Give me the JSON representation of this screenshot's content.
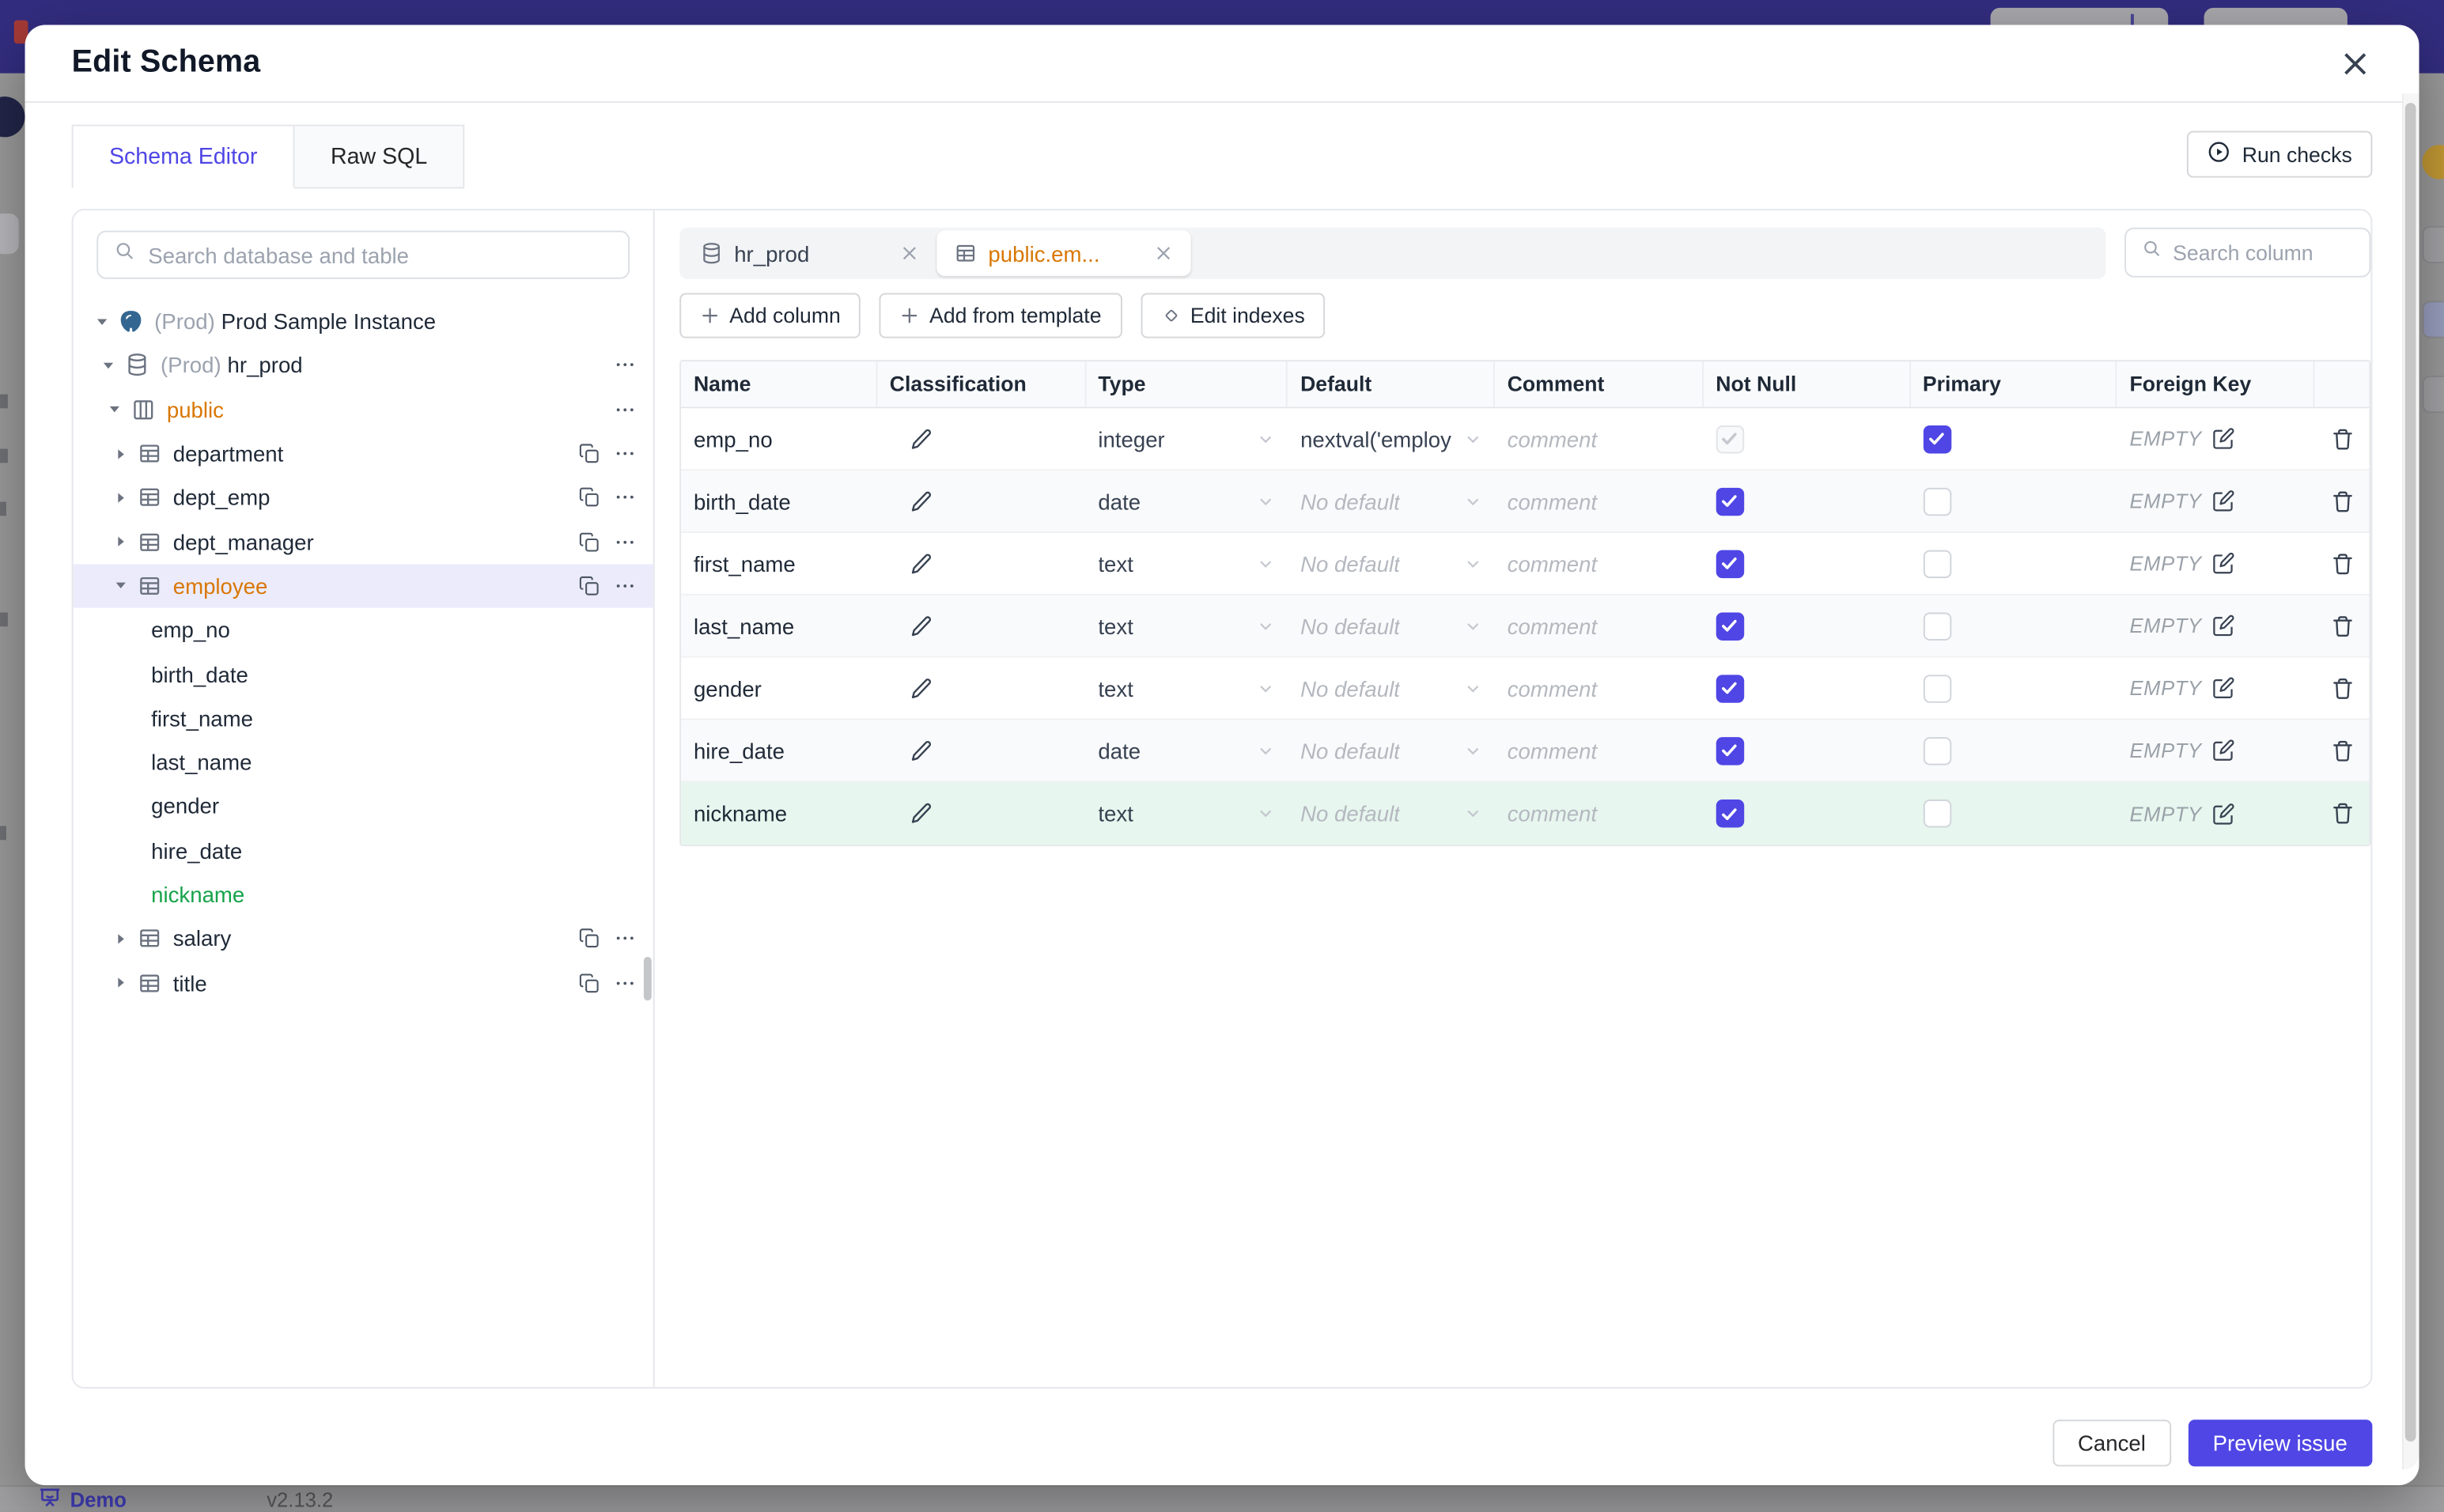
{
  "colors": {
    "accent": "#4f46e5",
    "amber": "#d97706",
    "green": "#16a34a",
    "navy": "#332d80",
    "highlight": "#e7f6ee"
  },
  "backdrop": {
    "bottombar": {
      "demo_label": "Demo",
      "version": "v2.13.2"
    }
  },
  "modal": {
    "title": "Edit Schema",
    "run_checks_label": "Run checks",
    "tabs": [
      {
        "label": "Schema Editor",
        "active": true
      },
      {
        "label": "Raw SQL",
        "active": false
      }
    ],
    "sidebar": {
      "search_placeholder": "Search database and table",
      "tree": [
        {
          "level": 0,
          "arrow": "down",
          "icon": "postgres",
          "prefix": "(Prod)",
          "label": "Prod Sample Instance"
        },
        {
          "level": 1,
          "arrow": "down",
          "icon": "database",
          "prefix": "(Prod)",
          "label": "hr_prod",
          "more": true
        },
        {
          "level": 2,
          "arrow": "down",
          "icon": "schema",
          "label": "public",
          "color": "amber",
          "more": true
        },
        {
          "level": 3,
          "arrow": "right",
          "icon": "table",
          "label": "department",
          "copy": true,
          "more": true
        },
        {
          "level": 3,
          "arrow": "right",
          "icon": "table",
          "label": "dept_emp",
          "copy": true,
          "more": true
        },
        {
          "level": 3,
          "arrow": "right",
          "icon": "table",
          "label": "dept_manager",
          "copy": true,
          "more": true
        },
        {
          "level": 3,
          "arrow": "down",
          "icon": "table",
          "label": "employee",
          "color": "amber",
          "selected": true,
          "copy": true,
          "more": true
        },
        {
          "level": 4,
          "label": "emp_no"
        },
        {
          "level": 4,
          "label": "birth_date"
        },
        {
          "level": 4,
          "label": "first_name"
        },
        {
          "level": 4,
          "label": "last_name"
        },
        {
          "level": 4,
          "label": "gender"
        },
        {
          "level": 4,
          "label": "hire_date"
        },
        {
          "level": 4,
          "label": "nickname",
          "color": "green"
        },
        {
          "level": 3,
          "arrow": "right",
          "icon": "table",
          "label": "salary",
          "copy": true,
          "more": true
        },
        {
          "level": 3,
          "arrow": "right",
          "icon": "table",
          "label": "title",
          "copy": true,
          "more": true
        }
      ]
    },
    "editor": {
      "chips": [
        {
          "label": "hr_prod",
          "icon": "database",
          "active": false
        },
        {
          "label": "public.em...",
          "icon": "table",
          "active": true
        }
      ],
      "column_search_placeholder": "Search column",
      "actions": [
        {
          "label": "Add column",
          "icon": "plus"
        },
        {
          "label": "Add from template",
          "icon": "plus"
        },
        {
          "label": "Edit indexes",
          "icon": "diamond"
        }
      ],
      "table": {
        "headers": [
          "Name",
          "Classification",
          "Type",
          "Default",
          "Comment",
          "Not Null",
          "Primary",
          "Foreign Key",
          ""
        ],
        "comment_placeholder": "comment",
        "foreign_key_empty": "EMPTY",
        "rows": [
          {
            "name": "emp_no",
            "type": "integer",
            "default": "nextval('employ",
            "default_is_placeholder": false,
            "not_null": "checked-disabled",
            "primary": "checked",
            "highlight": false
          },
          {
            "name": "birth_date",
            "type": "date",
            "default": "No default",
            "default_is_placeholder": true,
            "not_null": "checked",
            "primary": "unchecked",
            "highlight": false
          },
          {
            "name": "first_name",
            "type": "text",
            "default": "No default",
            "default_is_placeholder": true,
            "not_null": "checked",
            "primary": "unchecked",
            "highlight": false
          },
          {
            "name": "last_name",
            "type": "text",
            "default": "No default",
            "default_is_placeholder": true,
            "not_null": "checked",
            "primary": "unchecked",
            "highlight": false
          },
          {
            "name": "gender",
            "type": "text",
            "default": "No default",
            "default_is_placeholder": true,
            "not_null": "checked",
            "primary": "unchecked",
            "highlight": false
          },
          {
            "name": "hire_date",
            "type": "date",
            "default": "No default",
            "default_is_placeholder": true,
            "not_null": "checked",
            "primary": "unchecked",
            "highlight": false
          },
          {
            "name": "nickname",
            "type": "text",
            "default": "No default",
            "default_is_placeholder": true,
            "not_null": "checked",
            "primary": "unchecked",
            "highlight": true
          }
        ]
      }
    },
    "footer": {
      "cancel_label": "Cancel",
      "submit_label": "Preview issue"
    }
  }
}
